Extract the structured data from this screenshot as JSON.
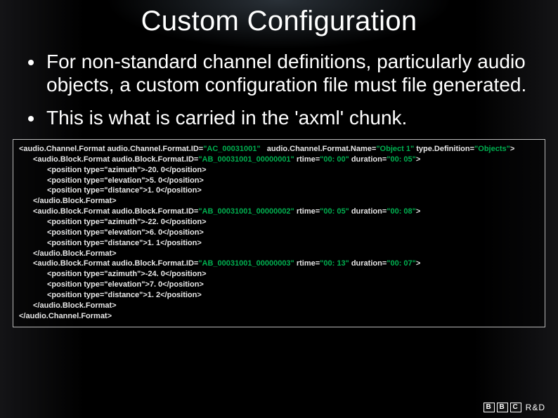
{
  "title": "Custom Configuration",
  "bullets": [
    "For non-standard channel definitions, particularly audio objects, a custom configuration file must file generated.",
    "This is what is carried in the 'axml' chunk."
  ],
  "code": {
    "open": {
      "tag": "<audio.Channel.Format audio.Channel.Format.ID=",
      "id": "\"AC_00031001\"",
      "mid": "   audio.Channel.Format.Name=",
      "name": "\"Object 1\"",
      "mid2": " type.Definition=",
      "type": "\"Objects\"",
      "end": ">"
    },
    "blocks": [
      {
        "prefix": "<audio.Block.Format audio.Block.Format.ID=",
        "id": "\"AB_00031001_00000001\"",
        "mid": " rtime=",
        "rtime": "\"00: 00\"",
        "mid2": " duration=",
        "duration": "\"00: 05\"",
        "end": ">",
        "positions": [
          "<position type=\"azimuth\">-20. 0</position>",
          "<position type=\"elevation\">5. 0</position>",
          "<position type=\"distance\">1. 0</position>"
        ],
        "close": "</audio.Block.Format>"
      },
      {
        "prefix": "<audio.Block.Format audio.Block.Format.ID=",
        "id": "\"AB_00031001_00000002\"",
        "mid": " rtime=",
        "rtime": "\"00: 05\"",
        "mid2": " duration=",
        "duration": "\"00: 08\"",
        "end": ">",
        "positions": [
          "<position type=\"azimuth\">-22. 0</position>",
          "<position type=\"elevation\">6. 0</position>",
          "<position type=\"distance\">1. 1</position>"
        ],
        "close": "</audio.Block.Format>"
      },
      {
        "prefix": "<audio.Block.Format audio.Block.Format.ID=",
        "id": "\"AB_00031001_00000003\"",
        "mid": " rtime=",
        "rtime": "\"00: 13\"",
        "mid2": " duration=",
        "duration": "\"00: 07\"",
        "end": ">",
        "positions": [
          "<position type=\"azimuth\">-24. 0</position>",
          "<position type=\"elevation\">7. 0</position>",
          "<position type=\"distance\">1. 2</position>"
        ],
        "close": "</audio.Block.Format>"
      }
    ],
    "close": "</audio.Channel.Format>"
  },
  "footer": {
    "b0": "B",
    "b1": "B",
    "b2": "C",
    "rnd": "R&D"
  }
}
